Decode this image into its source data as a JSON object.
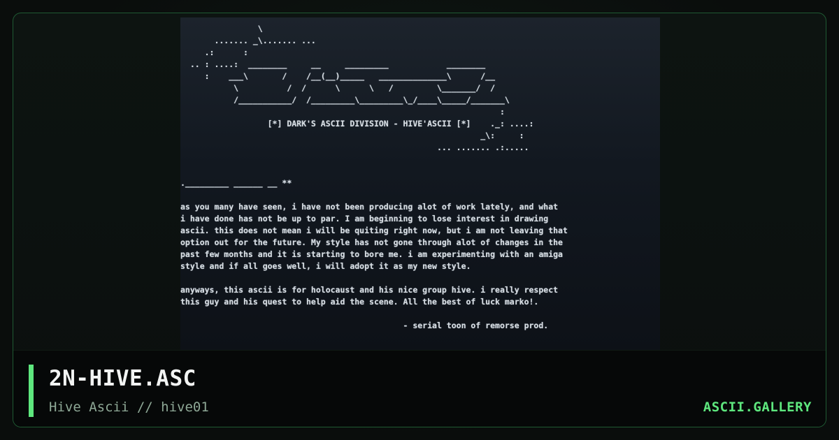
{
  "artwork": {
    "lines": [
      "                \\",
      "       ....... _\\....... ...",
      "     .:      :",
      "  .. : ....:  ________     __     _________            ________",
      "     :    ___\\       /    /__(__)_____   ______________\\      /__",
      "           \\          /  /      \\      \\   /         \\_______/  /",
      "           /___________/  /_________\\_________\\_/____\\_____/_______\\",
      "                                                                  :",
      "                  [*] DARK'S ASCII DIVISION - HIVE'ASCII [*]    ._: ....:",
      "                                                              _\\:     :",
      "                                                     ... ....... .:.....",
      "",
      "",
      "._________ ______ __ **",
      "",
      "as you many have seen, i have not been producing alot of work lately, and what",
      "i have done has not be up to par. I am beginning to lose interest in drawing",
      "ascii. this does not mean i will be quiting right now, but i am not leaving that",
      "option out for the future. My style has not gone through alot of changes in the",
      "past few months and it is starting to bore me. i am experimenting with an amiga",
      "style and if all goes well, i will adopt it as my new style.",
      "",
      "anyways, this ascii is for holocaust and his nice group hive. i really respect",
      "this guy and his quest to help aid the scene. All the best of luck marko!.",
      "",
      "                                              - serial toon of remorse prod."
    ]
  },
  "footer": {
    "title": "2N-HIVE.ASC",
    "subtitle": "Hive Ascii // hive01",
    "brand": "ASCII.GALLERY"
  },
  "colors": {
    "accent": "#5ee77e",
    "frame_border": "#1f5a33",
    "background": "#0b0e0d"
  }
}
